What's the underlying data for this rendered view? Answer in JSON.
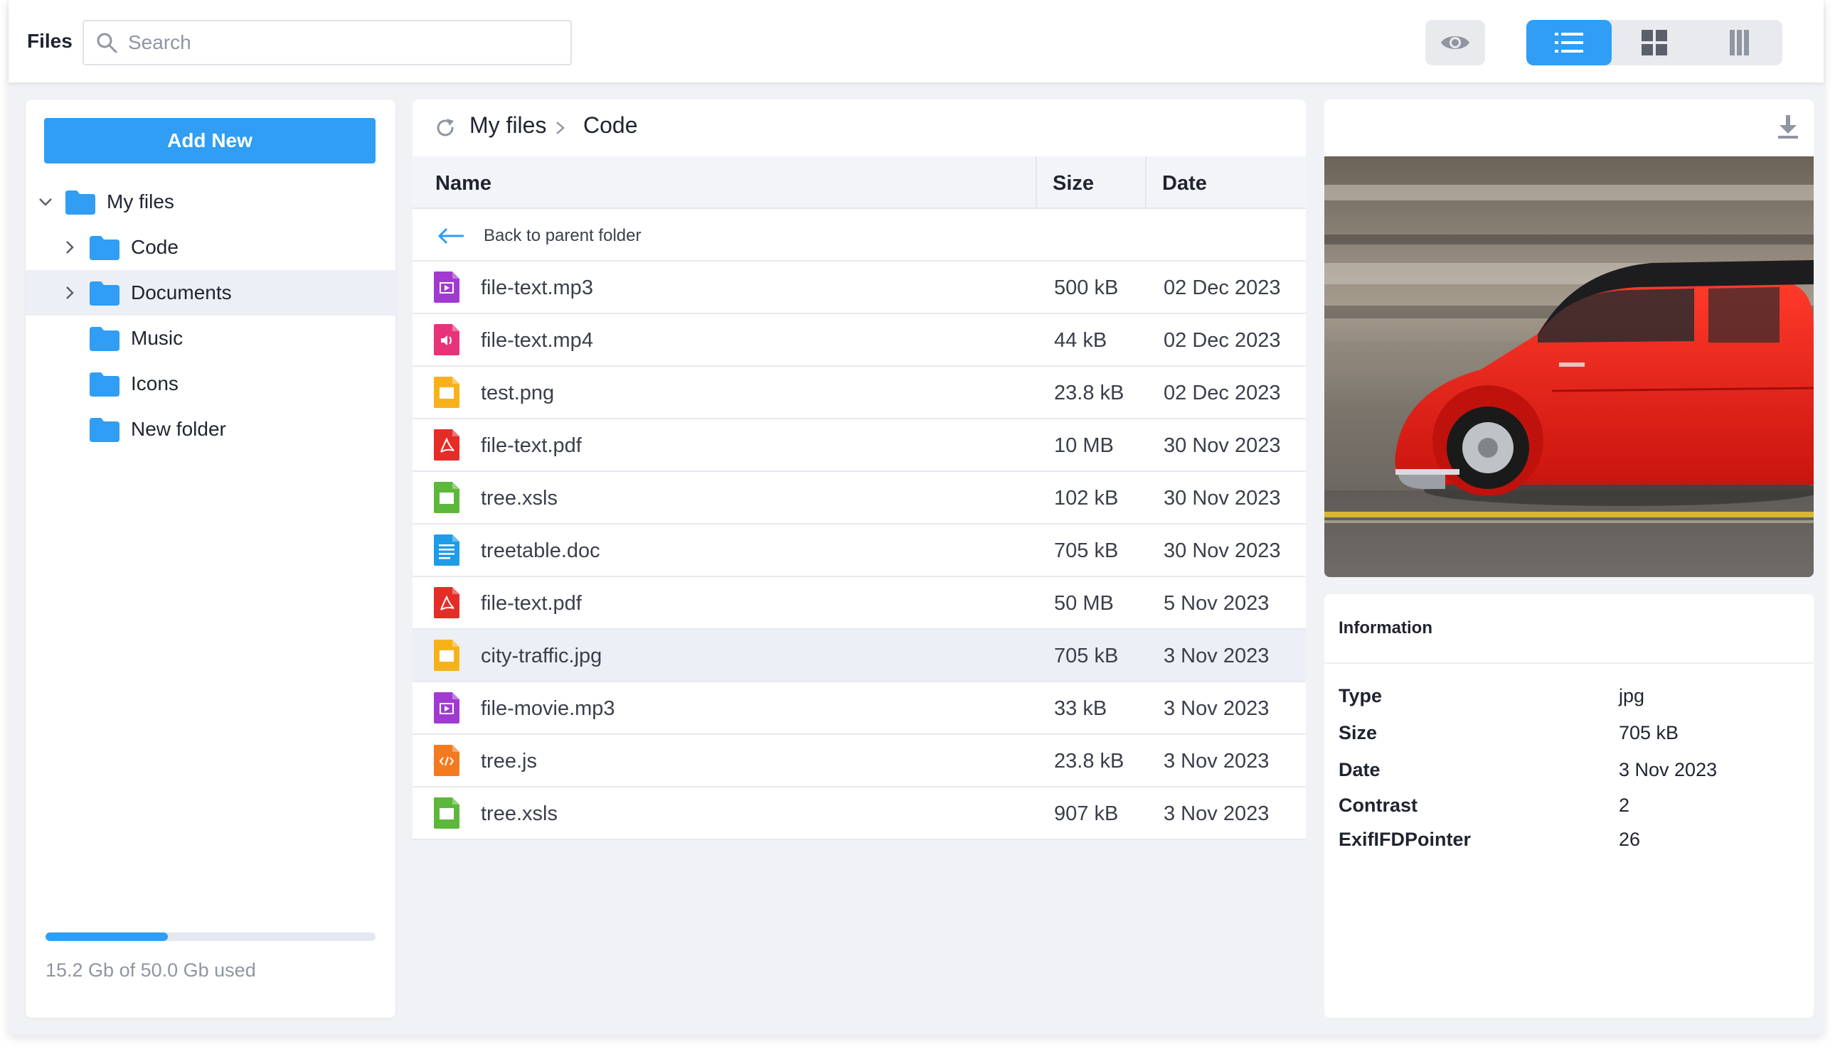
{
  "app": {
    "title": "Files"
  },
  "search": {
    "placeholder": "Search",
    "value": ""
  },
  "toolbar": {
    "preview_icon": "eye-icon",
    "views": [
      "list-view-icon",
      "grid-view-icon",
      "columns-view-icon"
    ],
    "active_view": "list"
  },
  "sidebar": {
    "add_button": "Add New",
    "tree": [
      {
        "label": "My files",
        "level": 0,
        "expanded": true,
        "has_children": true,
        "selected": false
      },
      {
        "label": "Code",
        "level": 1,
        "expanded": false,
        "has_children": true,
        "selected": false
      },
      {
        "label": "Documents",
        "level": 1,
        "expanded": false,
        "has_children": true,
        "selected": true
      },
      {
        "label": "Music",
        "level": 1,
        "expanded": false,
        "has_children": false,
        "selected": false
      },
      {
        "label": "Icons",
        "level": 1,
        "expanded": false,
        "has_children": false,
        "selected": false
      },
      {
        "label": "New folder",
        "level": 1,
        "expanded": false,
        "has_children": false,
        "selected": false
      }
    ],
    "usage": {
      "text": "15.2 Gb of 50.0 Gb used",
      "fraction": 0.37
    }
  },
  "breadcrumb": [
    "My files",
    "Code"
  ],
  "table": {
    "columns": {
      "name": "Name",
      "size": "Size",
      "date": "Date"
    },
    "back_label": "Back to parent folder",
    "rows": [
      {
        "name": "file-text.mp3",
        "size": "500 kB",
        "date": "02 Dec 2023",
        "icon": "audio-file-icon"
      },
      {
        "name": "file-text.mp4",
        "size": "44 kB",
        "date": "02 Dec 2023",
        "icon": "video-file-icon"
      },
      {
        "name": "test.png",
        "size": "23.8 kB",
        "date": "02 Dec 2023",
        "icon": "image-file-icon"
      },
      {
        "name": "file-text.pdf",
        "size": "10 MB",
        "date": "30 Nov 2023",
        "icon": "pdf-file-icon"
      },
      {
        "name": "tree.xsls",
        "size": "102 kB",
        "date": "30 Nov 2023",
        "icon": "spreadsheet-file-icon"
      },
      {
        "name": "treetable.doc",
        "size": "705 kB",
        "date": "30 Nov 2023",
        "icon": "document-file-icon"
      },
      {
        "name": "file-text.pdf",
        "size": "50 MB",
        "date": "5 Nov 2023",
        "icon": "pdf-file-icon"
      },
      {
        "name": "city-traffic.jpg",
        "size": "705 kB",
        "date": "3 Nov 2023",
        "icon": "image-file-icon",
        "selected": true
      },
      {
        "name": "file-movie.mp3",
        "size": "33 kB",
        "date": "3 Nov 2023",
        "icon": "audio-file-icon"
      },
      {
        "name": "tree.js",
        "size": "23.8 kB",
        "date": "3 Nov 2023",
        "icon": "code-file-icon"
      },
      {
        "name": "tree.xsls",
        "size": "907 kB",
        "date": "3 Nov 2023",
        "icon": "spreadsheet-file-icon"
      }
    ]
  },
  "info": {
    "title": "Information",
    "fields": [
      {
        "key": "Type",
        "value": "jpg"
      },
      {
        "key": "Size",
        "value": "705 kB"
      },
      {
        "key": "Date",
        "value": "3 Nov 2023"
      },
      {
        "key": "Contrast",
        "value": "2"
      },
      {
        "key": "ExifIFDPointer",
        "value": "26"
      }
    ]
  },
  "colors": {
    "accent": "#2f9ef4",
    "folder": "#2f9ef4",
    "audio": "#a13ad0",
    "video": "#e8337a",
    "image": "#f7b21b",
    "pdf": "#e52d27",
    "spreadsheet": "#5cb83a",
    "document": "#1e9ce8",
    "code": "#f47a20"
  }
}
